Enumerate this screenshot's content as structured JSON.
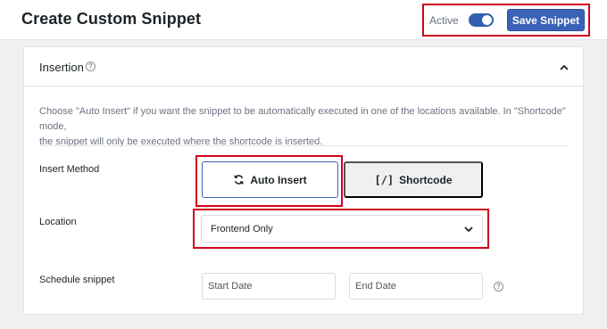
{
  "header": {
    "title": "Create Custom Snippet",
    "active_label": "Active",
    "active_on": true,
    "save_label": "Save Snippet"
  },
  "insertion": {
    "title": "Insertion",
    "description_line1": "Choose \"Auto Insert\" if you want the snippet to be automatically executed in one of the locations available. In \"Shortcode\" mode,",
    "description_line2": "the snippet will only be executed where the shortcode is inserted.",
    "insert_method_label": "Insert Method",
    "auto_insert_label": "Auto Insert",
    "shortcode_glyph": "[/]",
    "shortcode_label": "Shortcode",
    "location_label": "Location",
    "location_value": "Frontend Only",
    "schedule_label": "Schedule snippet",
    "start_date_placeholder": "Start Date",
    "end_date_placeholder": "End Date"
  },
  "colors": {
    "accent": "#3a63b8",
    "highlight": "#d0021b"
  },
  "icons": [
    "help-icon",
    "chevron-up-icon",
    "refresh-icon",
    "chevron-down-icon"
  ]
}
